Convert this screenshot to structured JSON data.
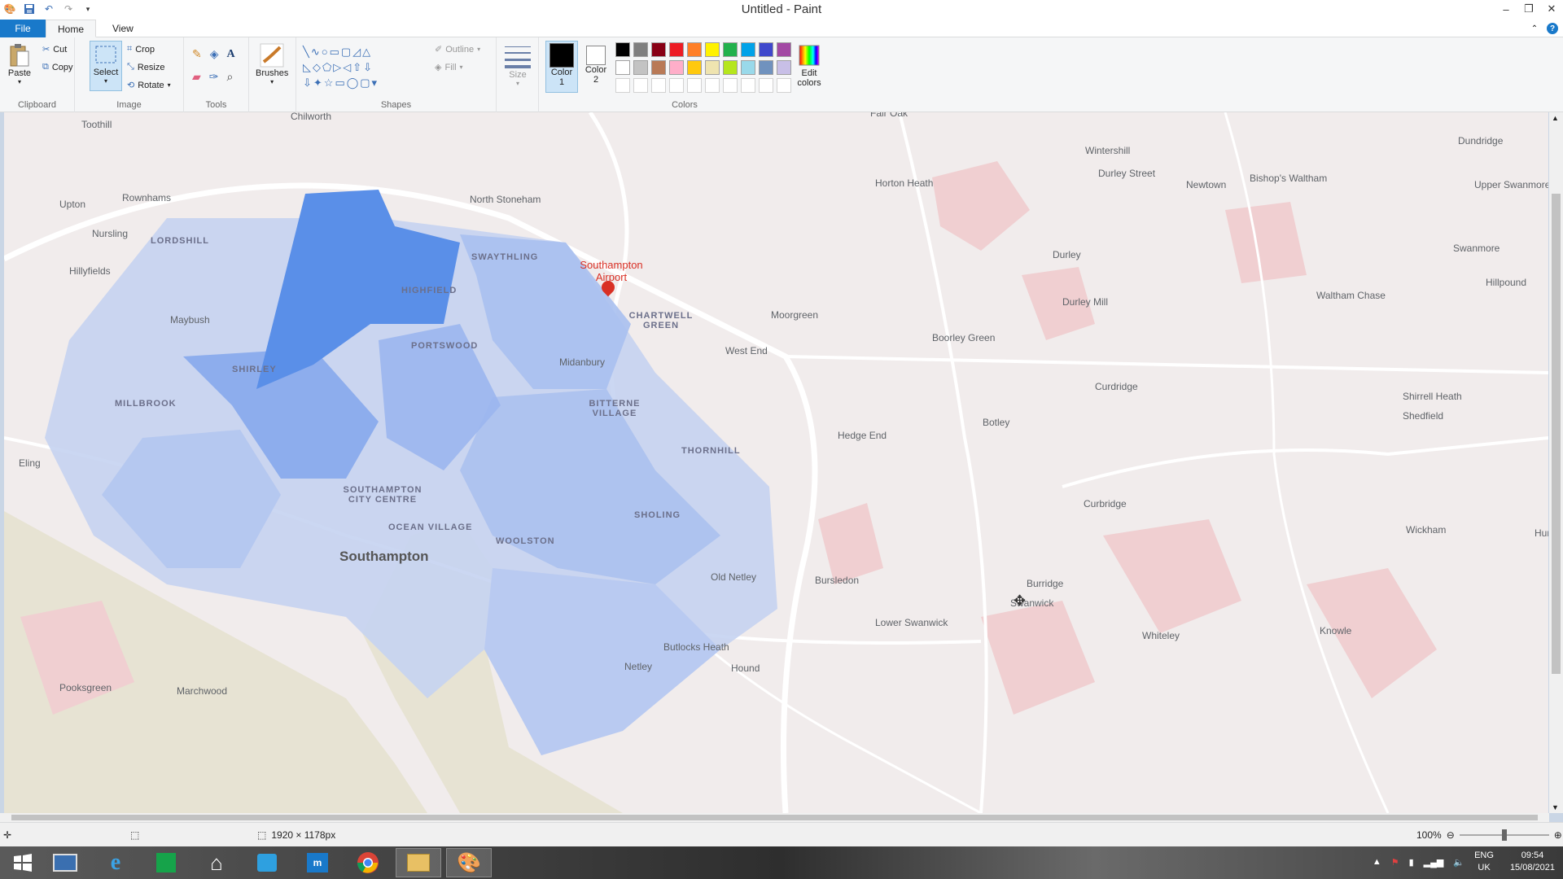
{
  "window": {
    "title": "Untitled - Paint",
    "minimize": "–",
    "restore": "❐",
    "close": "✕"
  },
  "tabs": {
    "file": "File",
    "home": "Home",
    "view": "View"
  },
  "ribbon": {
    "clipboard": {
      "label": "Clipboard",
      "paste": "Paste",
      "cut": "Cut",
      "copy": "Copy"
    },
    "image": {
      "label": "Image",
      "select": "Select",
      "crop": "Crop",
      "resize": "Resize",
      "rotate": "Rotate"
    },
    "tools": {
      "label": "Tools"
    },
    "brushes": {
      "label": "Brushes"
    },
    "shapes": {
      "label": "Shapes",
      "outline": "Outline",
      "fill": "Fill"
    },
    "size": {
      "label": "Size"
    },
    "colors": {
      "label": "Colors",
      "color1": "Color 1",
      "color2": "Color 2",
      "edit": "Edit colors",
      "color1_value": "#000000",
      "color2_value": "#ffffff",
      "palette_row1": [
        "#000000",
        "#7f7f7f",
        "#880015",
        "#ed1c24",
        "#ff7f27",
        "#fff200",
        "#22b14c",
        "#00a2e8",
        "#3f48cc",
        "#a349a4"
      ],
      "palette_row2": [
        "#ffffff",
        "#c3c3c3",
        "#b97a57",
        "#ffaec9",
        "#ffc90e",
        "#efe4b0",
        "#b5e61d",
        "#99d9ea",
        "#7092be",
        "#c8bfe7"
      ]
    }
  },
  "map": {
    "city": "Southampton",
    "airport": "Southampton Airport",
    "districts": [
      "LORDSHILL",
      "SWAYTHLING",
      "HIGHFIELD",
      "PORTSWOOD",
      "SHIRLEY",
      "MILLBROOK",
      "BITTERNE VILLAGE",
      "THORNHILL",
      "SHOLING",
      "WOOLSTON",
      "OCEAN VILLAGE",
      "SOUTHAMPTON CITY CENTRE",
      "CHARTWELL GREEN"
    ],
    "places": [
      "Chilworth",
      "Toothill",
      "Rownhams",
      "Upton",
      "Nursling",
      "North Stoneham",
      "Hillyfields",
      "Maybush",
      "Midanbury",
      "Eling",
      "Pooksgreen",
      "Marchwood",
      "Fair Oak",
      "Horton Heath",
      "Wintershill",
      "Durley Street",
      "Newtown",
      "Bishop's Waltham",
      "Dundridge",
      "Upper Swanmore",
      "Swanmore",
      "Hillpound",
      "Durley",
      "Durley Mill",
      "Waltham Chase",
      "Moorgreen",
      "West End",
      "Boorley Green",
      "Curdridge",
      "Shirrell Heath",
      "Shedfield",
      "Hedge End",
      "Botley",
      "Curbridge",
      "Wickham",
      "Hundr",
      "Old Netley",
      "Bursledon",
      "Burridge",
      "Swanwick",
      "Lower Swanwick",
      "Whiteley",
      "Knowle",
      "Butlocks Heath",
      "Netley",
      "Hound"
    ]
  },
  "status": {
    "dimensions": "1920 × 1178px",
    "zoom": "100%",
    "zoom_level": 0.5
  },
  "taskbar": {
    "lang_top": "ENG",
    "lang_bottom": "UK",
    "time": "09:54",
    "date": "15/08/2021"
  }
}
